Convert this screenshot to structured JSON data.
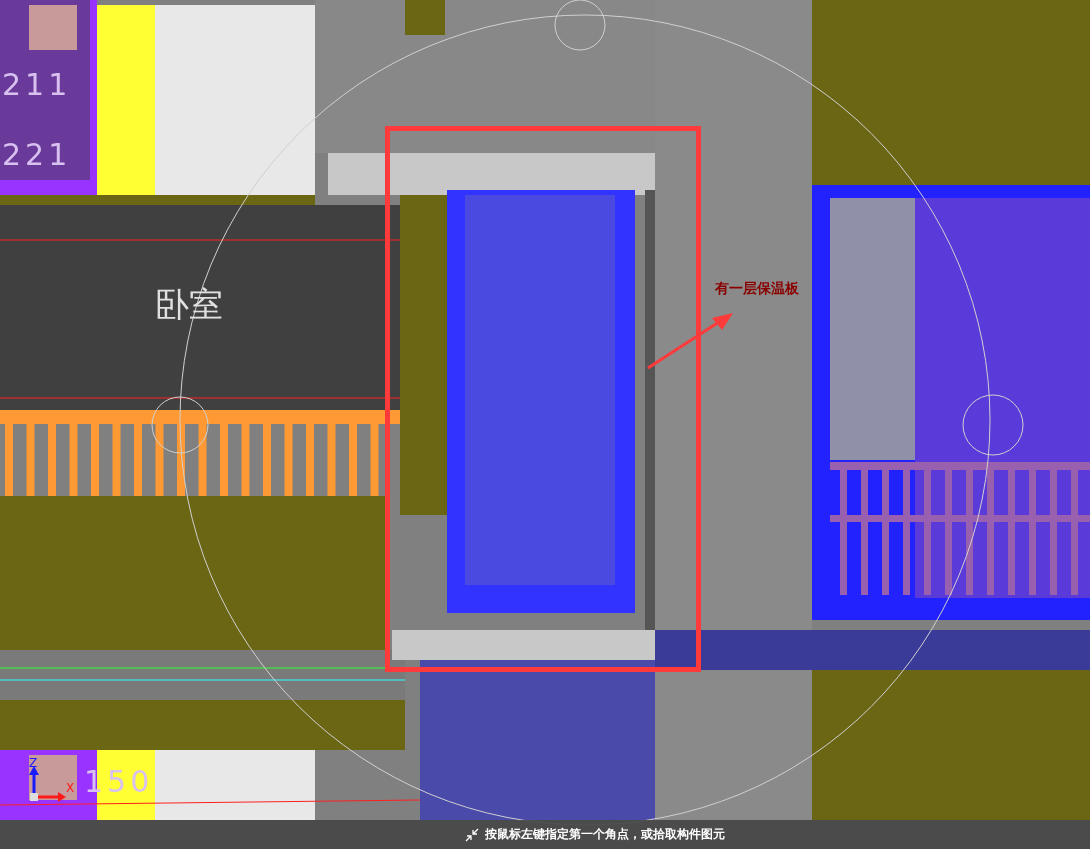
{
  "viewport": {
    "room_label": "卧室",
    "annotation": "有一层保温板",
    "grid_labels": [
      "211",
      "221",
      "150"
    ],
    "axis_labels": [
      "Z",
      "X"
    ]
  },
  "status_bar": {
    "prompt": "按鼠标左键指定第一个角点，或拾取构件图元"
  }
}
